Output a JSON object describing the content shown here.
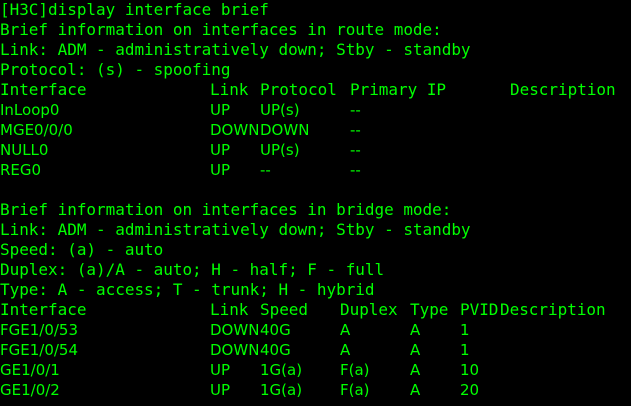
{
  "terminal": {
    "prompt": "[H3C]display interface brief",
    "route_section": {
      "heading": "Brief information on interfaces in route mode:",
      "legend_link": "Link: ADM - administratively down; Stby - standby",
      "legend_protocol": "Protocol: (s) - spoofing",
      "columns": {
        "interface": "Interface",
        "link": "Link",
        "protocol": "Protocol",
        "primary_ip": "Primary IP",
        "description": "Description"
      },
      "rows": [
        {
          "interface": "InLoop0",
          "link": "UP",
          "protocol": "UP(s)",
          "primary_ip": "--"
        },
        {
          "interface": "MGE0/0/0",
          "link": "DOWN",
          "protocol": "DOWN",
          "primary_ip": "--"
        },
        {
          "interface": "NULL0",
          "link": "UP",
          "protocol": "UP(s)",
          "primary_ip": "--"
        },
        {
          "interface": "REG0",
          "link": "UP",
          "protocol": "--",
          "primary_ip": "--"
        }
      ]
    },
    "bridge_section": {
      "heading": "Brief information on interfaces in bridge mode:",
      "legend_link": "Link: ADM - administratively down; Stby - standby",
      "legend_speed": "Speed: (a) - auto",
      "legend_duplex": "Duplex: (a)/A - auto; H - half; F - full",
      "legend_type": "Type: A - access; T - trunk; H - hybrid",
      "columns": {
        "interface": "Interface",
        "link": "Link",
        "speed": "Speed",
        "duplex": "Duplex",
        "type": "Type",
        "pvid": "PVID",
        "description": "Description"
      },
      "rows": [
        {
          "interface": "FGE1/0/53",
          "link": "DOWN",
          "speed": "40G",
          "duplex": "A",
          "type": "A",
          "pvid": "1"
        },
        {
          "interface": "FGE1/0/54",
          "link": "DOWN",
          "speed": "40G",
          "duplex": "A",
          "type": "A",
          "pvid": "1"
        },
        {
          "interface": "GE1/0/1",
          "link": "UP",
          "speed": "1G(a)",
          "duplex": "F(a)",
          "type": "A",
          "pvid": "10"
        },
        {
          "interface": "GE1/0/2",
          "link": "UP",
          "speed": "1G(a)",
          "duplex": "F(a)",
          "type": "A",
          "pvid": "20"
        }
      ]
    },
    "colors": {
      "background": "#000000",
      "text": "#00ff00"
    }
  }
}
